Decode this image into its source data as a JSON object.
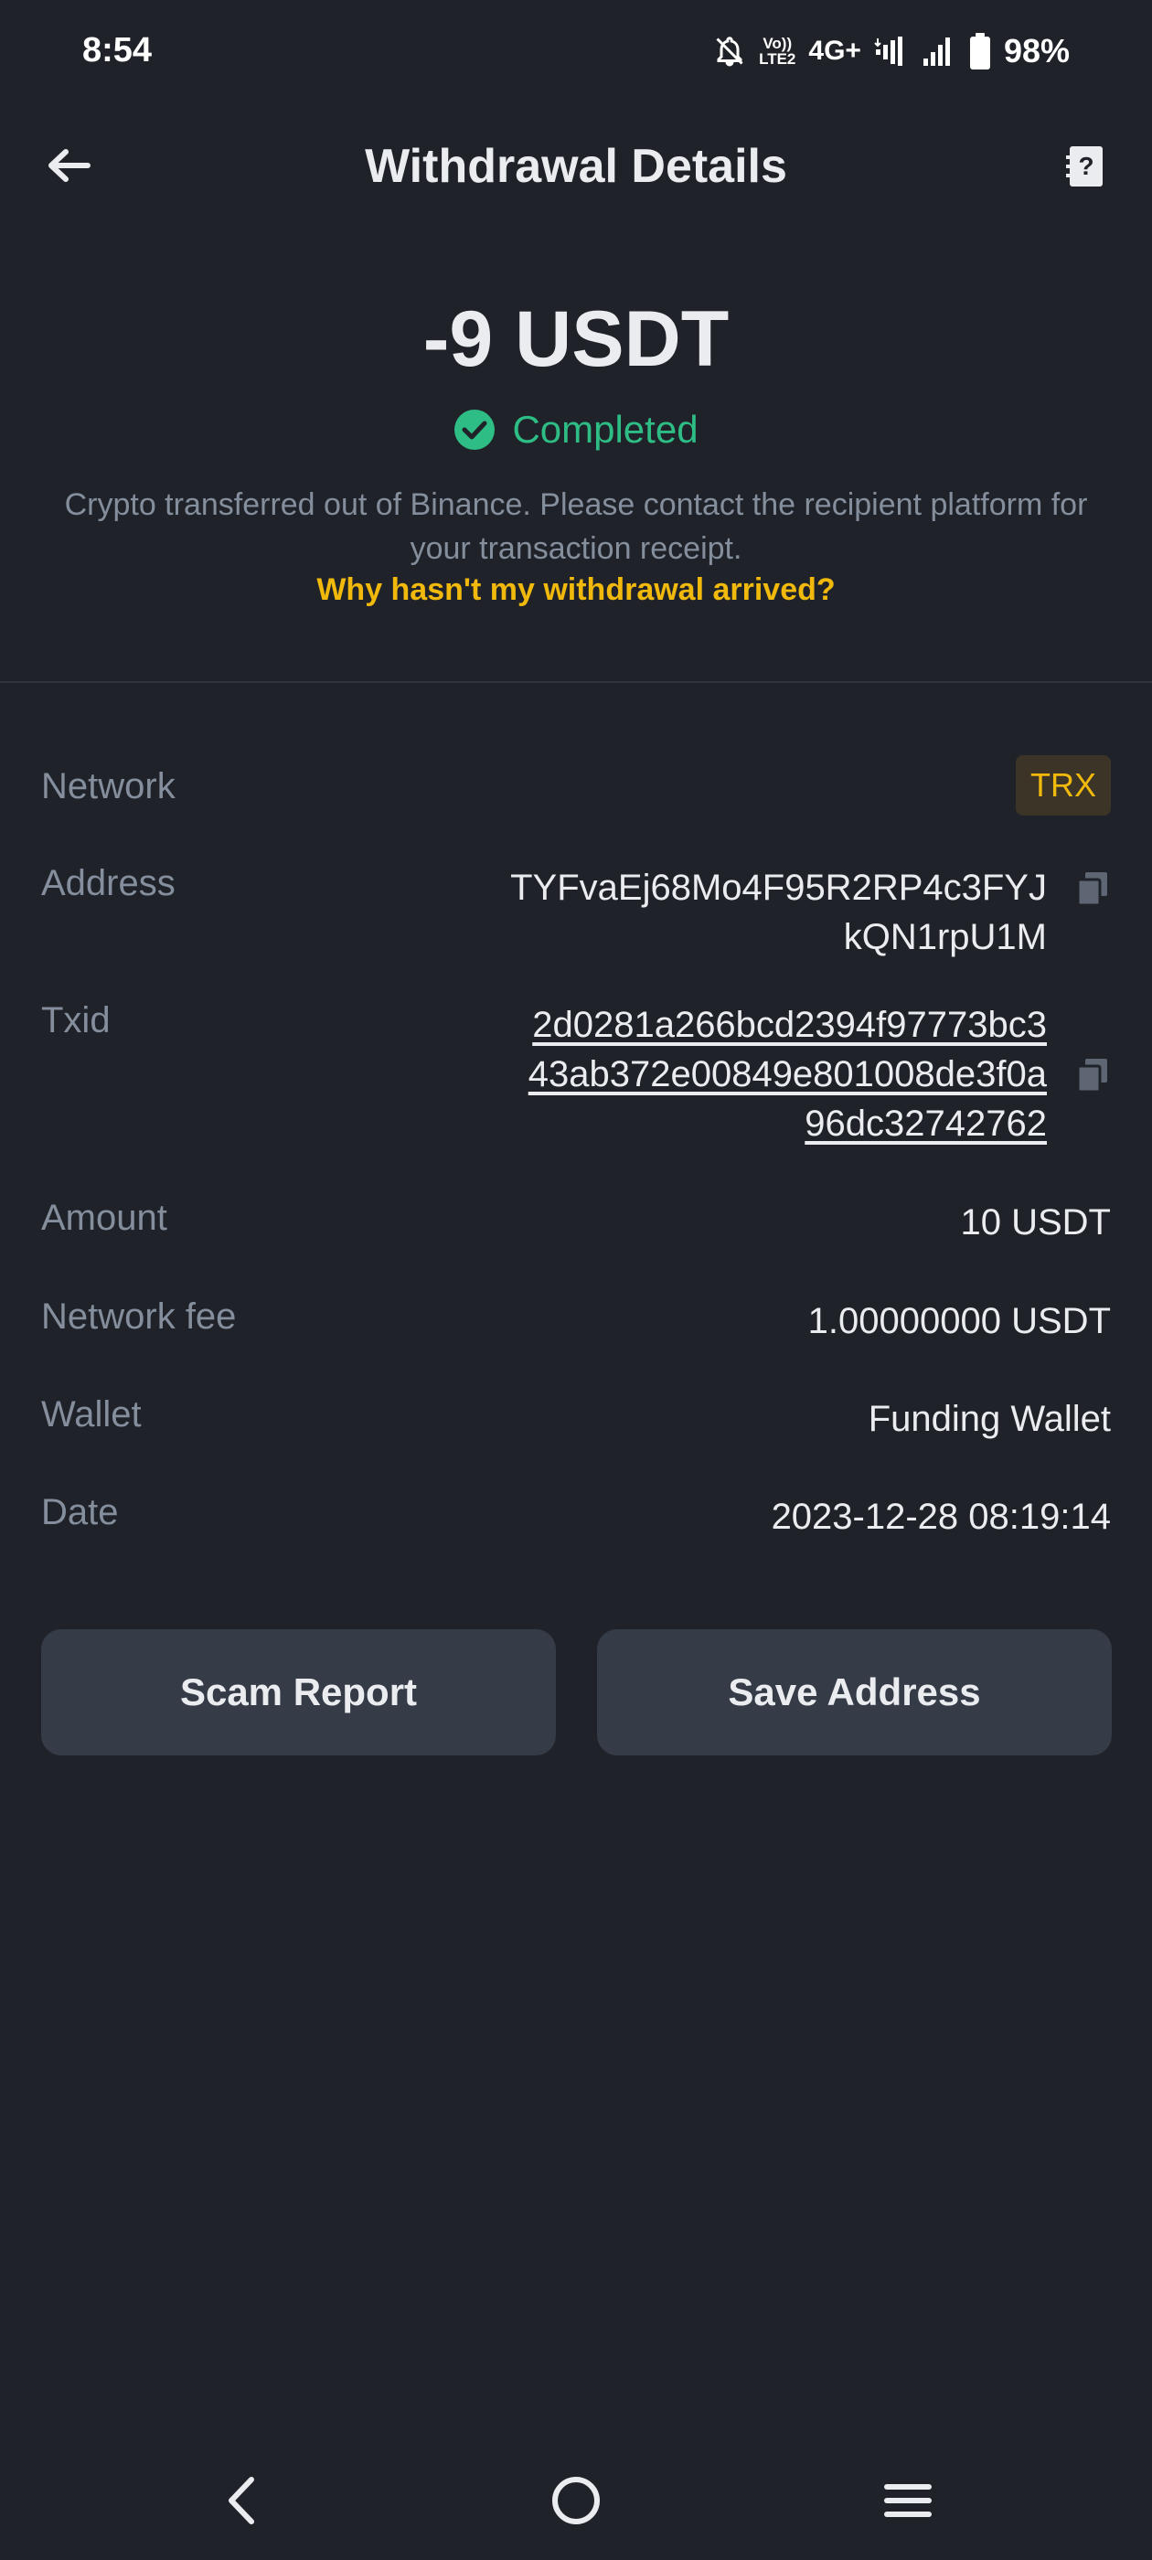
{
  "status_bar": {
    "time": "8:54",
    "network_type": "4G+",
    "volte_top": "Vo))",
    "volte_bottom": "LTE2",
    "battery_percent": "98%"
  },
  "header": {
    "title": "Withdrawal Details"
  },
  "summary": {
    "amount": "-9 USDT",
    "status": "Completed",
    "description": "Crypto transferred out of Binance. Please contact the recipient platform for your transaction receipt.",
    "help_link": "Why hasn't my withdrawal arrived?"
  },
  "details": {
    "network": {
      "label": "Network",
      "value": "TRX"
    },
    "address": {
      "label": "Address",
      "line1": "TYFvaEj68Mo4F95R2RP4c3FYJ",
      "line2": "kQN1rpU1M"
    },
    "txid": {
      "label": "Txid",
      "line1": "2d0281a266bcd2394f97773bc3",
      "line2": "43ab372e00849e801008de3f0a",
      "line3": "96dc32742762"
    },
    "amount": {
      "label": "Amount",
      "value": "10 USDT"
    },
    "network_fee": {
      "label": "Network fee",
      "value": "1.00000000 USDT"
    },
    "wallet": {
      "label": "Wallet",
      "value": "Funding Wallet"
    },
    "date": {
      "label": "Date",
      "value": "2023-12-28 08:19:14"
    }
  },
  "buttons": {
    "scam_report": "Scam Report",
    "save_address": "Save Address"
  },
  "colors": {
    "background": "#1f2329",
    "accent": "#f0b90b",
    "success": "#2ebd85",
    "muted": "#848e9c",
    "button": "#363c47"
  },
  "icons": [
    "back-arrow-icon",
    "help-document-icon",
    "check-circle-icon",
    "copy-icon",
    "nav-back-icon",
    "nav-home-icon",
    "nav-menu-icon",
    "mute-icon",
    "signal-icon",
    "battery-icon"
  ]
}
